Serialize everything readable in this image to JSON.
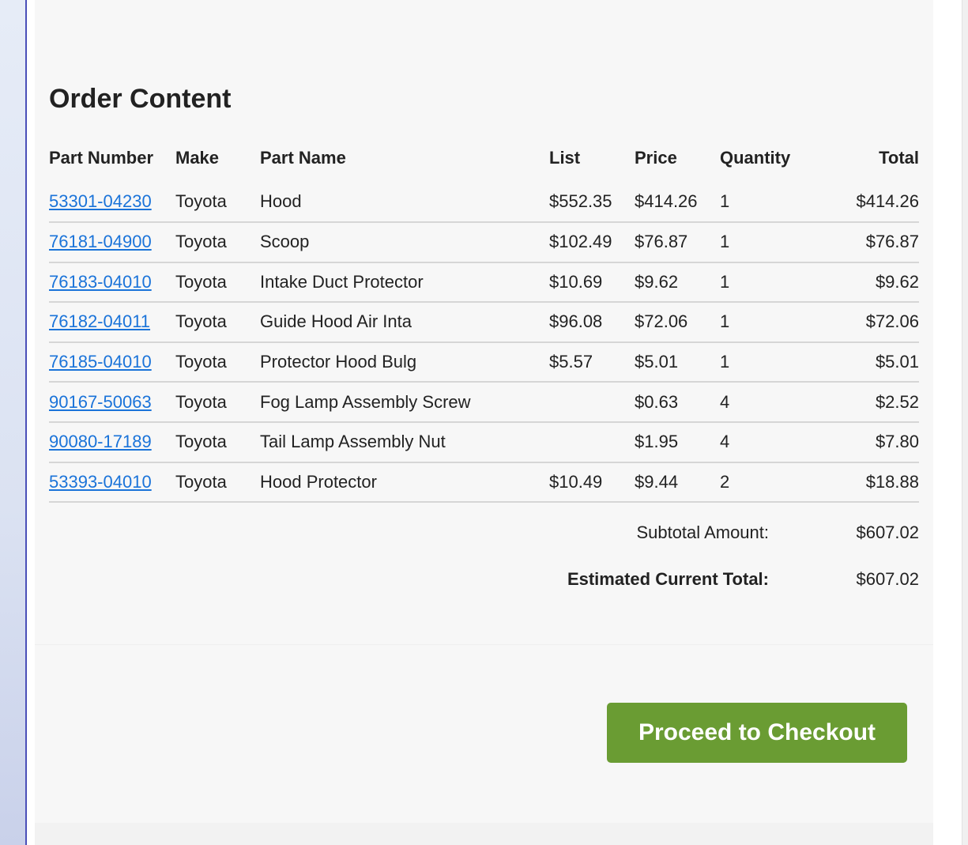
{
  "order": {
    "title": "Order Content",
    "columns": {
      "part_number": "Part Number",
      "make": "Make",
      "part_name": "Part Name",
      "list": "List",
      "price": "Price",
      "quantity": "Quantity",
      "total": "Total"
    },
    "rows": [
      {
        "part_number": "53301-04230",
        "make": "Toyota",
        "part_name": "Hood",
        "list": "$552.35",
        "price": "$414.26",
        "quantity": "1",
        "total": "$414.26"
      },
      {
        "part_number": "76181-04900",
        "make": "Toyota",
        "part_name": "Scoop",
        "list": "$102.49",
        "price": "$76.87",
        "quantity": "1",
        "total": "$76.87"
      },
      {
        "part_number": "76183-04010",
        "make": "Toyota",
        "part_name": "Intake Duct Protector",
        "list": "$10.69",
        "price": "$9.62",
        "quantity": "1",
        "total": "$9.62"
      },
      {
        "part_number": "76182-04011",
        "make": "Toyota",
        "part_name": "Guide Hood Air Inta",
        "list": "$96.08",
        "price": "$72.06",
        "quantity": "1",
        "total": "$72.06"
      },
      {
        "part_number": "76185-04010",
        "make": "Toyota",
        "part_name": "Protector Hood Bulg",
        "list": "$5.57",
        "price": "$5.01",
        "quantity": "1",
        "total": "$5.01"
      },
      {
        "part_number": "90167-50063",
        "make": "Toyota",
        "part_name": "Fog Lamp Assembly Screw",
        "list": "",
        "price": "$0.63",
        "quantity": "4",
        "total": "$2.52"
      },
      {
        "part_number": "90080-17189",
        "make": "Toyota",
        "part_name": "Tail Lamp Assembly Nut",
        "list": "",
        "price": "$1.95",
        "quantity": "4",
        "total": "$7.80"
      },
      {
        "part_number": "53393-04010",
        "make": "Toyota",
        "part_name": "Hood Protector",
        "list": "$10.49",
        "price": "$9.44",
        "quantity": "2",
        "total": "$18.88"
      }
    ],
    "subtotal_label": "Subtotal Amount:",
    "subtotal_value": "$607.02",
    "estimated_label": "Estimated Current Total:",
    "estimated_value": "$607.02"
  },
  "checkout": {
    "button_label": "Proceed to Checkout"
  },
  "colors": {
    "link": "#1a73d9",
    "checkout_button": "#6a9c33",
    "panel_background": "#f7f7f7"
  }
}
